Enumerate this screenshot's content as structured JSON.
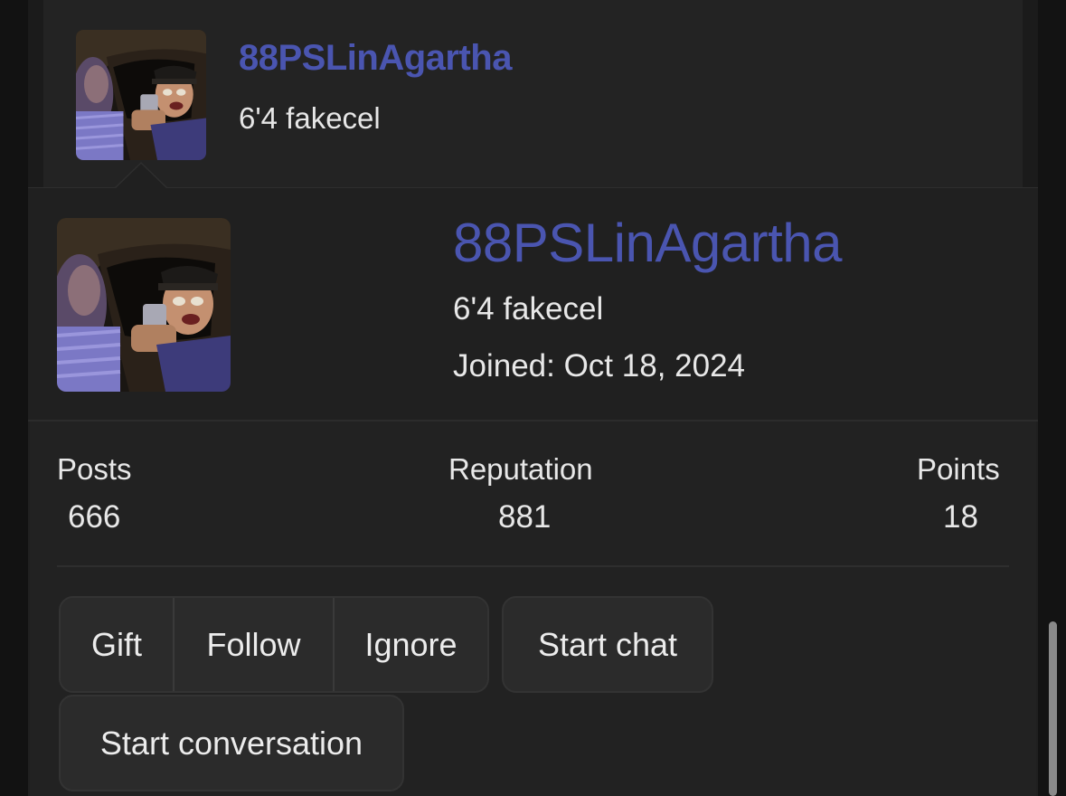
{
  "post": {
    "username": "88PSLinAgartha",
    "user_title": "6'4 fakecel"
  },
  "member_card": {
    "username": "88PSLinAgartha",
    "user_title": "6'4 fakecel",
    "joined": "Joined: Oct 18, 2024",
    "stats": [
      {
        "label": "Posts",
        "value": "666"
      },
      {
        "label": "Reputation",
        "value": "881"
      },
      {
        "label": "Points",
        "value": "18"
      }
    ],
    "buttons": {
      "gift": "Gift",
      "follow": "Follow",
      "ignore": "Ignore",
      "start_chat": "Start chat",
      "start_conversation": "Start conversation"
    }
  },
  "colors": {
    "username": "#4a55b0",
    "background": "#202020",
    "button_bg": "#2b2b2b"
  }
}
